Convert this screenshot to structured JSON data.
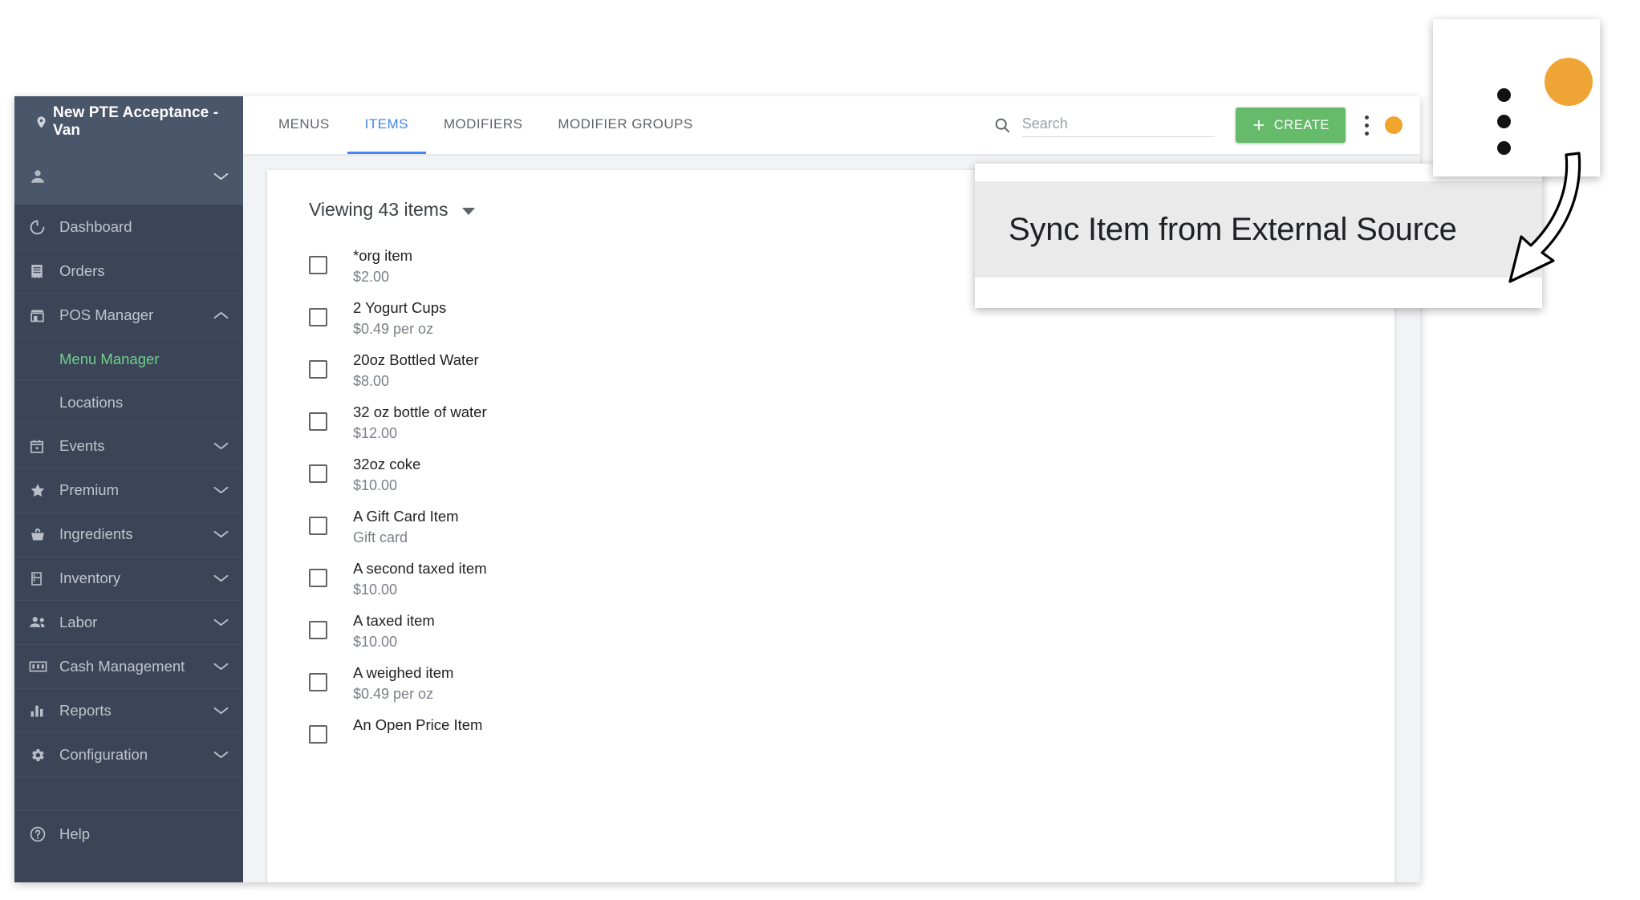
{
  "sidebar": {
    "location_name": "New PTE Acceptance - Van",
    "location_icon": "map-pin-icon",
    "user_icon": "person-icon",
    "items": [
      {
        "label": "Dashboard",
        "icon": "dashboard-ring-icon",
        "chevron": false
      },
      {
        "label": "Orders",
        "icon": "receipt-icon",
        "chevron": false
      },
      {
        "label": "POS Manager",
        "icon": "storefront-icon",
        "chevron": true,
        "expanded": true
      },
      {
        "label": "Events",
        "icon": "calendar-icon",
        "chevron": true
      },
      {
        "label": "Premium",
        "icon": "star-icon",
        "chevron": true
      },
      {
        "label": "Ingredients",
        "icon": "basket-icon",
        "chevron": true
      },
      {
        "label": "Inventory",
        "icon": "fridge-icon",
        "chevron": true
      },
      {
        "label": "Labor",
        "icon": "people-icon",
        "chevron": true
      },
      {
        "label": "Cash Management",
        "icon": "cash-drawer-icon",
        "chevron": true
      },
      {
        "label": "Reports",
        "icon": "bar-chart-icon",
        "chevron": true
      },
      {
        "label": "Configuration",
        "icon": "gear-icon",
        "chevron": true
      }
    ],
    "subitems": [
      {
        "label": "Menu Manager",
        "active": true
      },
      {
        "label": "Locations",
        "active": false
      }
    ],
    "help": {
      "label": "Help",
      "icon": "help-circle-icon"
    },
    "colors": {
      "top_bg": "#4a5669",
      "bg": "#3b4557",
      "active_text": "#6fd08c"
    }
  },
  "topbar": {
    "tabs": [
      {
        "label": "MENUS",
        "active": false
      },
      {
        "label": "ITEMS",
        "active": true
      },
      {
        "label": "MODIFIERS",
        "active": false
      },
      {
        "label": "MODIFIER GROUPS",
        "active": false
      }
    ],
    "search": {
      "placeholder": "Search",
      "value": "",
      "icon": "search-icon"
    },
    "create_label": "CREATE",
    "create_icon": "plus-icon",
    "overflow_icon": "kebab-menu-icon",
    "avatar_icon": "user-avatar",
    "colors": {
      "tab_active": "#4285f4",
      "create_bg": "#66bb6a",
      "avatar_bg": "#f0a42e"
    }
  },
  "content": {
    "viewing_label": "Viewing 43 items",
    "viewing_caret_icon": "caret-down-icon",
    "items": [
      {
        "name": "*org item",
        "sub": "$2.00"
      },
      {
        "name": "2 Yogurt Cups",
        "sub": "$0.49 per oz"
      },
      {
        "name": "20oz Bottled Water",
        "sub": "$8.00"
      },
      {
        "name": "32 oz bottle of water",
        "sub": "$12.00"
      },
      {
        "name": "32oz coke",
        "sub": "$10.00"
      },
      {
        "name": "A Gift Card Item",
        "sub": "Gift card"
      },
      {
        "name": "A second taxed item",
        "sub": "$10.00"
      },
      {
        "name": "A taxed item",
        "sub": "$10.00"
      },
      {
        "name": "A weighed item",
        "sub": "$0.49 per oz"
      },
      {
        "name": "An Open Price Item",
        "sub": ""
      }
    ]
  },
  "callout": {
    "text": "Sync Item from External Source"
  },
  "inset": {
    "kebab_icon": "kebab-menu-icon",
    "avatar_icon": "user-avatar",
    "avatar_color": "#efa536"
  }
}
